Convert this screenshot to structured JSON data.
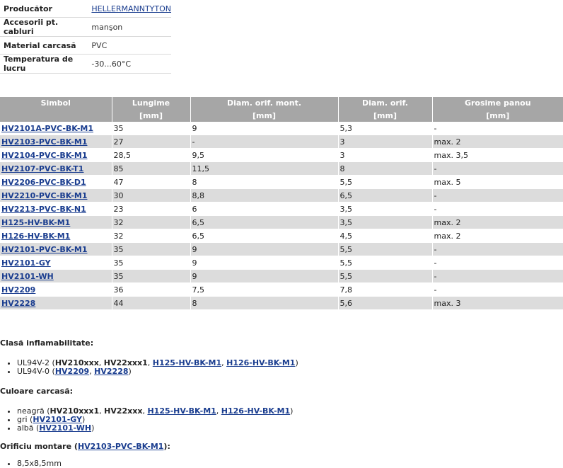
{
  "properties": [
    {
      "key": "Producător",
      "value": "HELLERMANNTYTON",
      "link": true
    },
    {
      "key": "Accesorii pt. cabluri",
      "value": "manşon",
      "link": false
    },
    {
      "key": "Material carcasă",
      "value": "PVC",
      "link": false
    },
    {
      "key": "Temperatura de lucru",
      "value": "-30...60°C",
      "link": false
    }
  ],
  "table": {
    "headers": [
      "Simbol",
      "Lungime",
      "Diam. orif. mont.",
      "Diam. orif.",
      "Grosime panou"
    ],
    "units": [
      "",
      "[mm]",
      "[mm]",
      "[mm]",
      "[mm]"
    ],
    "rows": [
      [
        "HV2101A-PVC-BK-M1",
        "35",
        "9",
        "5,3",
        "-"
      ],
      [
        "HV2103-PVC-BK-M1",
        "27",
        "-",
        "3",
        "max. 2"
      ],
      [
        "HV2104-PVC-BK-M1",
        "28,5",
        "9,5",
        "3",
        "max. 3,5"
      ],
      [
        "HV2107-PVC-BK-T1",
        "85",
        "11,5",
        "8",
        "-"
      ],
      [
        "HV2206-PVC-BK-D1",
        "47",
        "8",
        "5,5",
        "max. 5"
      ],
      [
        "HV2210-PVC-BK-M1",
        "30",
        "8,8",
        "6,5",
        "-"
      ],
      [
        "HV2213-PVC-BK-N1",
        "23",
        "6",
        "3,5",
        "-"
      ],
      [
        "H125-HV-BK-M1",
        "32",
        "6,5",
        "3,5",
        "max. 2"
      ],
      [
        "H126-HV-BK-M1",
        "32",
        "6,5",
        "4,5",
        "max. 2"
      ],
      [
        "HV2101-PVC-BK-M1",
        "35",
        "9",
        "5,5",
        "-"
      ],
      [
        "HV2101-GY",
        "35",
        "9",
        "5,5",
        "-"
      ],
      [
        "HV2101-WH",
        "35",
        "9",
        "5,5",
        "-"
      ],
      [
        "HV2209",
        "36",
        "7,5",
        "7,8",
        "-"
      ],
      [
        "HV2228",
        "44",
        "8",
        "5,6",
        "max. 3"
      ]
    ]
  },
  "notes": {
    "flammability": {
      "title": "Clasă inflamabilitate:",
      "item1": {
        "text": "UL94V-2 (",
        "bold1": "HV210xxx",
        "sep1": ", ",
        "bold2": "HV22xxx1",
        "sep2": ", ",
        "link1": "H125-HV-BK-M1",
        "sep3": ", ",
        "link2": "H126-HV-BK-M1",
        "end": ")"
      },
      "item2": {
        "text": "UL94V-0 (",
        "link1": "HV2209",
        "sep1": ", ",
        "link2": "HV2228",
        "end": ")"
      }
    },
    "color": {
      "title": "Culoare carcasă:",
      "item1": {
        "text": "neagră (",
        "bold1": "HV210xxx1",
        "sep1": ", ",
        "bold2": "HV22xxx",
        "sep2": ", ",
        "link1": "H125-HV-BK-M1",
        "sep3": ", ",
        "link2": "H126-HV-BK-M1",
        "end": ")"
      },
      "item2": {
        "text": "gri (",
        "link1": "HV2101-GY",
        "end": ")"
      },
      "item3": {
        "text": "albă (",
        "link1": "HV2101-WH",
        "end": ")"
      }
    },
    "mounting": {
      "title_pre": "Orificiu montare (",
      "title_link": "HV2103-PVC-BK-M1",
      "title_post": "):",
      "item1": "8,5x8,5mm"
    }
  }
}
